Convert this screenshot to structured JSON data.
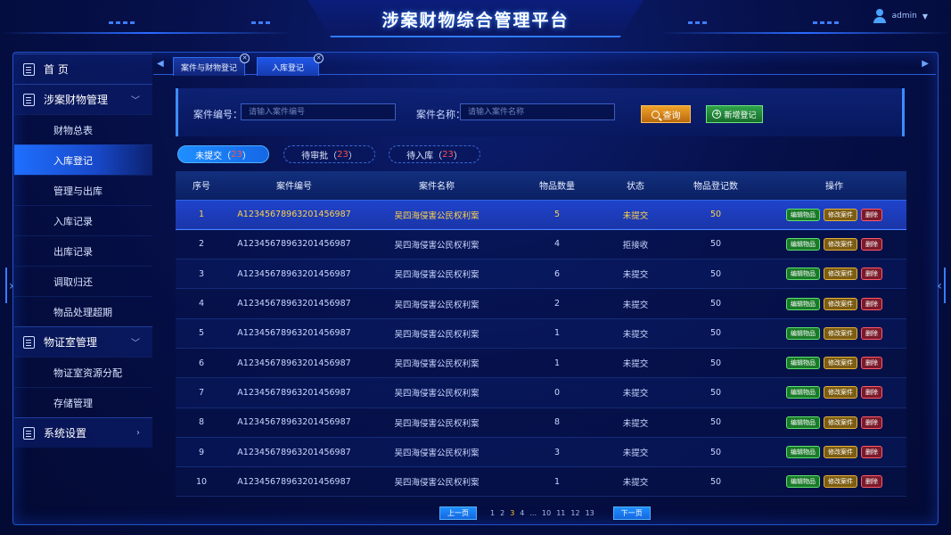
{
  "header": {
    "title": "涉案财物综合管理平台",
    "user": "admin"
  },
  "sidebar": {
    "groups": [
      {
        "label": "首  页",
        "icon": "document-icon",
        "items": []
      },
      {
        "label": "涉案财物管理",
        "icon": "document-icon",
        "items": [
          "财物总表",
          "入库登记",
          "管理与出库",
          "入库记录",
          "出库记录",
          "调取归还",
          "物品处理超期"
        ]
      },
      {
        "label": "物证室管理",
        "icon": "document-icon",
        "items": [
          "物证室资源分配",
          "存储管理"
        ]
      },
      {
        "label": "系统设置",
        "icon": "document-icon",
        "items": []
      }
    ],
    "active_item": "入库登记"
  },
  "tabs": [
    {
      "label": "案件与财物登记"
    },
    {
      "label": "入库登记"
    }
  ],
  "search": {
    "case_no_label": "案件编号：",
    "case_no_placeholder": "请输入案件编号",
    "case_name_label": "案件名称：",
    "case_name_placeholder": "请输入案件名称",
    "query_label": "查询",
    "add_label": "新增登记"
  },
  "status_tabs": [
    {
      "label": "未提交",
      "count": "23"
    },
    {
      "label": "待审批",
      "count": "23"
    },
    {
      "label": "待入库",
      "count": "23"
    }
  ],
  "table": {
    "headers": [
      "序号",
      "案件编号",
      "案件名称",
      "物品数量",
      "状态",
      "物品登记数",
      "操作"
    ],
    "actions": [
      "编辑物品",
      "修改案件",
      "删除"
    ],
    "rows": [
      [
        "1",
        "A12345678963201456987",
        "吴四海侵害公民权利案",
        "5",
        "未提交",
        "50"
      ],
      [
        "2",
        "A12345678963201456987",
        "吴四海侵害公民权利案",
        "4",
        "拒接收",
        "50"
      ],
      [
        "3",
        "A12345678963201456987",
        "吴四海侵害公民权利案",
        "6",
        "未提交",
        "50"
      ],
      [
        "4",
        "A12345678963201456987",
        "吴四海侵害公民权利案",
        "2",
        "未提交",
        "50"
      ],
      [
        "5",
        "A12345678963201456987",
        "吴四海侵害公民权利案",
        "1",
        "未提交",
        "50"
      ],
      [
        "6",
        "A12345678963201456987",
        "吴四海侵害公民权利案",
        "1",
        "未提交",
        "50"
      ],
      [
        "7",
        "A12345678963201456987",
        "吴四海侵害公民权利案",
        "0",
        "未提交",
        "50"
      ],
      [
        "8",
        "A12345678963201456987",
        "吴四海侵害公民权利案",
        "8",
        "未提交",
        "50"
      ],
      [
        "9",
        "A12345678963201456987",
        "吴四海侵害公民权利案",
        "3",
        "未提交",
        "50"
      ],
      [
        "10",
        "A12345678963201456987",
        "吴四海侵害公民权利案",
        "1",
        "未提交",
        "50"
      ]
    ]
  },
  "pagination": {
    "prev_label": "上一页",
    "next_label": "下一页",
    "pages": [
      "1",
      "2",
      "3",
      "4",
      "...",
      "10",
      "11",
      "12",
      "13"
    ],
    "current": "3"
  }
}
